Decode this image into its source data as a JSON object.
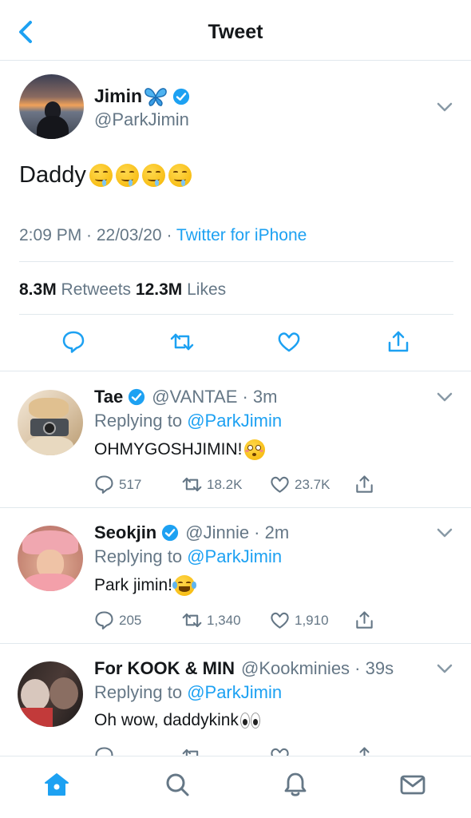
{
  "header": {
    "title": "Tweet",
    "back_icon": "chevron-left-icon"
  },
  "colors": {
    "accent": "#1da1f2",
    "text": "#14171a",
    "muted": "#657786",
    "border": "#e1e8ed"
  },
  "main_tweet": {
    "display_name": "Jimin",
    "name_emoji": "butterfly",
    "verified": true,
    "handle": "@ParkJimin",
    "text": "Daddy",
    "text_emojis": [
      "drooling-face",
      "drooling-face",
      "drooling-face",
      "drooling-face"
    ],
    "time": "2:09 PM · 22/03/20 · ",
    "source": "Twitter for iPhone",
    "retweets_count": "8.3M",
    "retweets_label": " Retweets ",
    "likes_count": "12.3M",
    "likes_label": " Likes",
    "actions": [
      "reply-icon",
      "retweet-icon",
      "like-icon",
      "share-icon"
    ]
  },
  "replies": [
    {
      "display_name": "Tae",
      "verified": true,
      "handle_time": "@VANTAE · 3m",
      "replying_prefix": "Replying to ",
      "replying_to": "@ParkJimin",
      "text": "OHMYGOSHJIMIN!",
      "emoji": "flushed-face",
      "reply_count": "517",
      "retweet_count": "18.2K",
      "like_count": "23.7K"
    },
    {
      "display_name": "Seokjin",
      "verified": true,
      "handle_time": "@Jinnie · 2m",
      "replying_prefix": "Replying to ",
      "replying_to": "@ParkJimin",
      "text": "Park jimin!",
      "emoji": "tears-of-joy-face",
      "reply_count": "205",
      "retweet_count": "1,340",
      "like_count": "1,910"
    },
    {
      "display_name": "For KOOK & MIN",
      "verified": false,
      "handle_time": "@Kookminies · 39s",
      "replying_prefix": "Replying to ",
      "replying_to": "@ParkJimin",
      "text": "Oh wow, daddykink",
      "emoji": "eyes",
      "reply_count": "",
      "retweet_count": "",
      "like_count": ""
    }
  ],
  "tabbar": {
    "tabs": [
      "home-icon",
      "search-icon",
      "notifications-icon",
      "messages-icon"
    ],
    "active": "home-icon"
  }
}
